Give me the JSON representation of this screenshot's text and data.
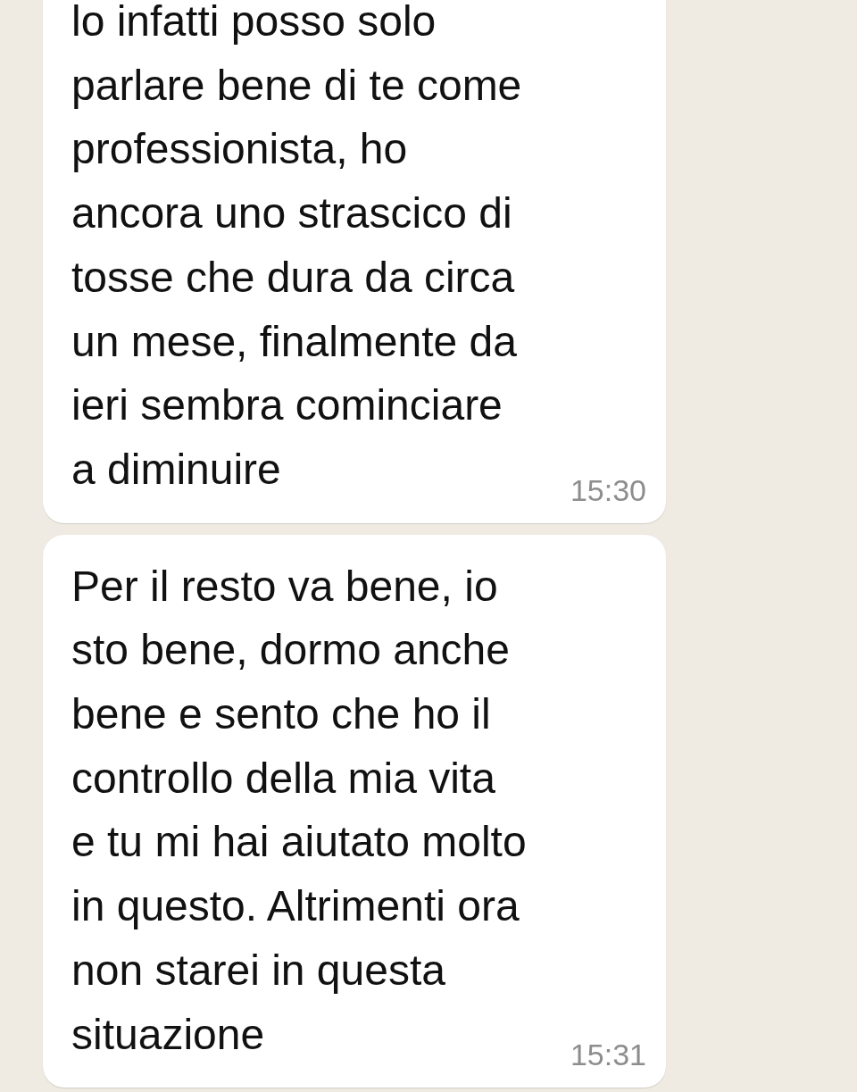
{
  "messages": [
    {
      "lines": [
        "lo infatti posso solo",
        "parlare bene di te come",
        "professionista, ho",
        "ancora uno strascico di",
        "tosse che dura da circa",
        "un mese, finalmente da",
        "ieri sembra cominciare",
        "a diminuire"
      ],
      "time": "15:30"
    },
    {
      "lines": [
        "Per il resto va bene, io",
        "sto bene, dormo anche",
        "bene e sento che ho il",
        "controllo della mia vita",
        "e tu mi hai aiutato molto",
        "in questo. Altrimenti ora",
        "non starei in questa",
        "situazione"
      ],
      "time": "15:31"
    }
  ]
}
